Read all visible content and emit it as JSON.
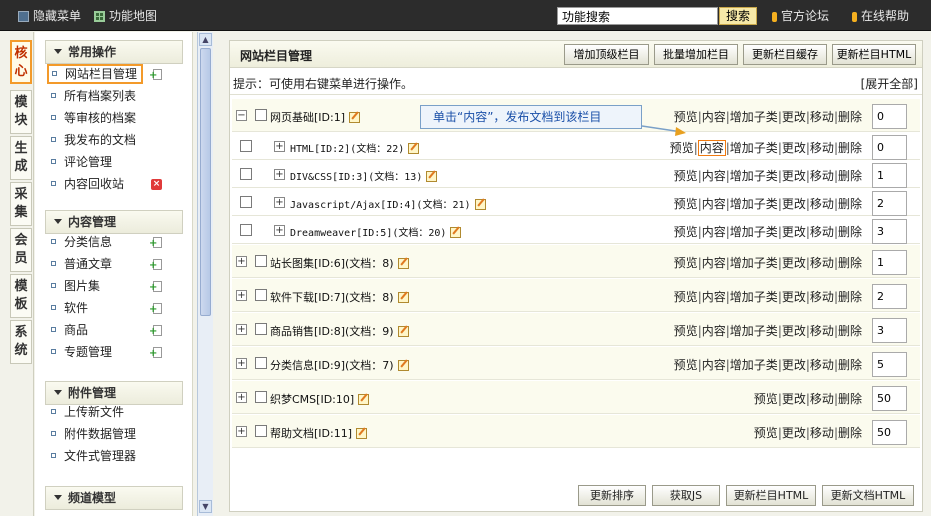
{
  "topbar": {
    "hide_menu": "隐藏菜单",
    "func_map": "功能地图",
    "search_placeholder": "功能搜索",
    "search_value": "功能搜索",
    "search_btn": "搜索",
    "forum": "官方论坛",
    "help": "在线帮助"
  },
  "vtabs": [
    {
      "label": "核\n心"
    },
    {
      "label": "模\n块"
    },
    {
      "label": "生\n成"
    },
    {
      "label": "采\n集"
    },
    {
      "label": "会\n员"
    },
    {
      "label": "模\n板"
    },
    {
      "label": "系\n统"
    }
  ],
  "sidebar": {
    "sections": [
      {
        "title": "常用操作",
        "items": [
          {
            "label": "网站栏目管理",
            "active": true,
            "icon": "add"
          },
          {
            "label": "所有档案列表"
          },
          {
            "label": "等审核的档案"
          },
          {
            "label": "我发布的文档"
          },
          {
            "label": "评论管理"
          },
          {
            "label": "内容回收站",
            "icon": "delete"
          }
        ]
      },
      {
        "title": "内容管理",
        "items": [
          {
            "label": "分类信息",
            "icon": "add"
          },
          {
            "label": "普通文章",
            "icon": "add"
          },
          {
            "label": "图片集",
            "icon": "add"
          },
          {
            "label": "软件",
            "icon": "add"
          },
          {
            "label": "商品",
            "icon": "add"
          },
          {
            "label": "专题管理",
            "icon": "add"
          }
        ]
      },
      {
        "title": "附件管理",
        "items": [
          {
            "label": "上传新文件"
          },
          {
            "label": "附件数据管理"
          },
          {
            "label": "文件式管理器"
          }
        ]
      },
      {
        "title": "频道模型",
        "items": []
      }
    ]
  },
  "main": {
    "title": "网站栏目管理",
    "header_buttons": [
      "增加顶级栏目",
      "批量增加栏目",
      "更新栏目缓存",
      "更新栏目HTML"
    ],
    "tip": "提示：可使用右键菜单进行操作。",
    "expand_all": "[展开全部]",
    "callout": "单击“内容”，发布文档到该栏目",
    "rows": [
      {
        "kind": "top",
        "toggle": "−",
        "name": "网页基础[ID:1]",
        "actions": [
          "预览",
          "内容",
          "增加子类",
          "更改",
          "移动",
          "删除"
        ],
        "order": "0"
      },
      {
        "kind": "sub",
        "name": "HTML[ID:2](文档：22)",
        "actions": [
          "预览",
          "内容",
          "增加子类",
          "更改",
          "移动",
          "删除"
        ],
        "order": "0",
        "highlight": "内容"
      },
      {
        "kind": "sub",
        "name": "DIV&CSS[ID:3](文档：13)",
        "actions": [
          "预览",
          "内容",
          "增加子类",
          "更改",
          "移动",
          "删除"
        ],
        "order": "1"
      },
      {
        "kind": "sub",
        "name": "Javascript/Ajax[ID:4](文档：21)",
        "actions": [
          "预览",
          "内容",
          "增加子类",
          "更改",
          "移动",
          "删除"
        ],
        "order": "2"
      },
      {
        "kind": "sub",
        "name": "Dreamweaver[ID:5](文档：20)",
        "actions": [
          "预览",
          "内容",
          "增加子类",
          "更改",
          "移动",
          "删除"
        ],
        "order": "3"
      },
      {
        "kind": "top",
        "toggle": "+",
        "name": "站长图集[ID:6](文档：8)",
        "actions": [
          "预览",
          "内容",
          "增加子类",
          "更改",
          "移动",
          "删除"
        ],
        "order": "1"
      },
      {
        "kind": "top",
        "toggle": "+",
        "name": "软件下载[ID:7](文档：8)",
        "actions": [
          "预览",
          "内容",
          "增加子类",
          "更改",
          "移动",
          "删除"
        ],
        "order": "2"
      },
      {
        "kind": "top",
        "toggle": "+",
        "name": "商品销售[ID:8](文档：9)",
        "actions": [
          "预览",
          "内容",
          "增加子类",
          "更改",
          "移动",
          "删除"
        ],
        "order": "3"
      },
      {
        "kind": "top",
        "toggle": "+",
        "name": "分类信息[ID:9](文档：7)",
        "actions": [
          "预览",
          "内容",
          "增加子类",
          "更改",
          "移动",
          "删除"
        ],
        "order": "5"
      },
      {
        "kind": "top",
        "toggle": "+",
        "name": "织梦CMS[ID:10]",
        "actions": [
          "预览",
          "更改",
          "移动",
          "删除"
        ],
        "order": "50"
      },
      {
        "kind": "top",
        "toggle": "+",
        "name": "帮助文档[ID:11]",
        "actions": [
          "预览",
          "更改",
          "移动",
          "删除"
        ],
        "order": "50"
      }
    ],
    "footer_buttons": [
      "更新排序",
      "获取JS",
      "更新栏目HTML",
      "更新文档HTML"
    ]
  }
}
